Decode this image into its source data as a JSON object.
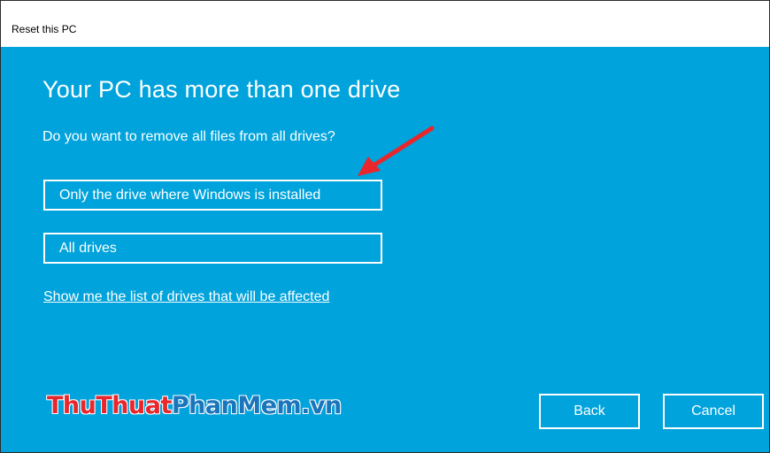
{
  "window": {
    "title": "Reset this PC"
  },
  "main": {
    "heading": "Your PC has more than one drive",
    "question": "Do you want to remove all files from all drives?",
    "options": [
      {
        "label": "Only the drive where Windows is installed"
      },
      {
        "label": "All drives"
      }
    ],
    "link": "Show me the list of drives that will be affected"
  },
  "watermark": {
    "part1": "Thu",
    "part2": "Thuat",
    "part3": "PhanMem.vn"
  },
  "footer": {
    "back_label": "Back",
    "cancel_label": "Cancel"
  },
  "colors": {
    "background": "#00A3DB",
    "text": "#FFFFFF",
    "arrow": "#E8262B"
  }
}
